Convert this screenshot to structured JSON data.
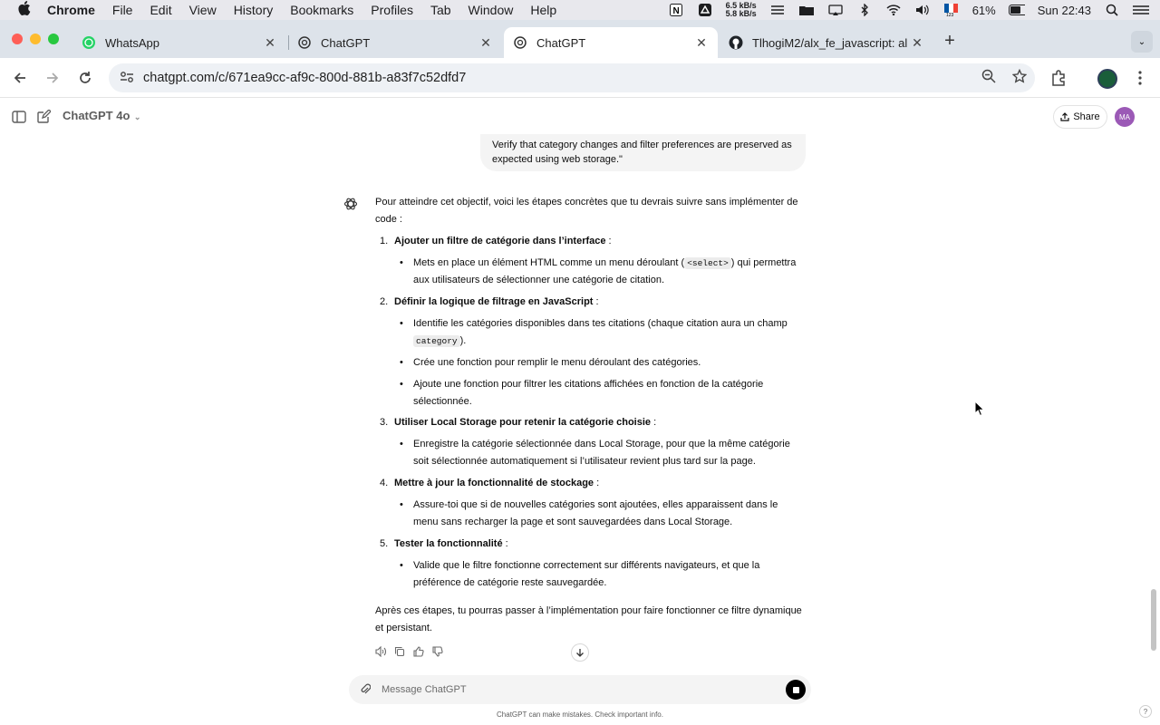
{
  "menubar": {
    "app": "Chrome",
    "items": [
      "File",
      "Edit",
      "View",
      "History",
      "Bookmarks",
      "Profiles",
      "Tab",
      "Window",
      "Help"
    ],
    "net_up": "6.5 kB/s",
    "net_down": "5.8 kB/s",
    "battery": "61%",
    "clock": "Sun 22:43"
  },
  "tabs": [
    {
      "title": "WhatsApp",
      "icon": "whatsapp-icon"
    },
    {
      "title": "ChatGPT",
      "icon": "openai-icon"
    },
    {
      "title": "ChatGPT",
      "icon": "openai-icon"
    },
    {
      "title": "TlhogiM2/alx_fe_javascript: al",
      "icon": "github-icon"
    }
  ],
  "address": {
    "url": "chatgpt.com/c/671ea9cc-af9c-800d-881b-a83f7c52dfd7"
  },
  "header": {
    "model": "ChatGPT 4o",
    "share": "Share",
    "avatar": "MA"
  },
  "user_message": {
    "text": "Verify that category changes and filter preferences are preserved as expected using web storage.\""
  },
  "assistant": {
    "intro": "Pour atteindre cet objectif, voici les étapes concrètes que tu devrais suivre sans implémenter de code :",
    "steps": [
      {
        "num": "1.",
        "title": "Ajouter un filtre de catégorie dans l’interface",
        "suffix": " :"
      },
      {
        "num": "2.",
        "title": "Définir la logique de filtrage en JavaScript",
        "suffix": " :"
      },
      {
        "num": "3.",
        "title": "Utiliser Local Storage pour retenir la catégorie choisie",
        "suffix": " :"
      },
      {
        "num": "4.",
        "title": "Mettre à jour la fonctionnalité de stockage",
        "suffix": " :"
      },
      {
        "num": "5.",
        "title": "Tester la fonctionnalité",
        "suffix": " :"
      }
    ],
    "b1a": "Mets en place un élément HTML comme un menu déroulant (",
    "b1code": "<select>",
    "b1b": ") qui permettra aux utilisateurs de sélectionner une catégorie de citation.",
    "b2a": "Identifie les catégories disponibles dans tes citations (chaque citation aura un champ ",
    "b2code": "category",
    "b2b": ").",
    "b3": "Crée une fonction pour remplir le menu déroulant des catégories.",
    "b4": "Ajoute une fonction pour filtrer les citations affichées en fonction de la catégorie sélectionnée.",
    "b5": "Enregistre la catégorie sélectionnée dans Local Storage, pour que la même catégorie soit sélectionnée automatiquement si l’utilisateur revient plus tard sur la page.",
    "b6": "Assure-toi que si de nouvelles catégories sont ajoutées, elles apparaissent dans le menu sans recharger la page et sont sauvegardées dans Local Storage.",
    "b7": "Valide que le filtre fonctionne correctement sur différents navigateurs, et que la préférence de catégorie reste sauvegardée.",
    "outro": "Après ces étapes, tu pourras passer à l’implémentation pour faire fonctionner ce filtre dynamique et persistant."
  },
  "composer": {
    "placeholder": "Message ChatGPT"
  },
  "disclaimer": "ChatGPT can make mistakes. Check important info.",
  "help": "?"
}
